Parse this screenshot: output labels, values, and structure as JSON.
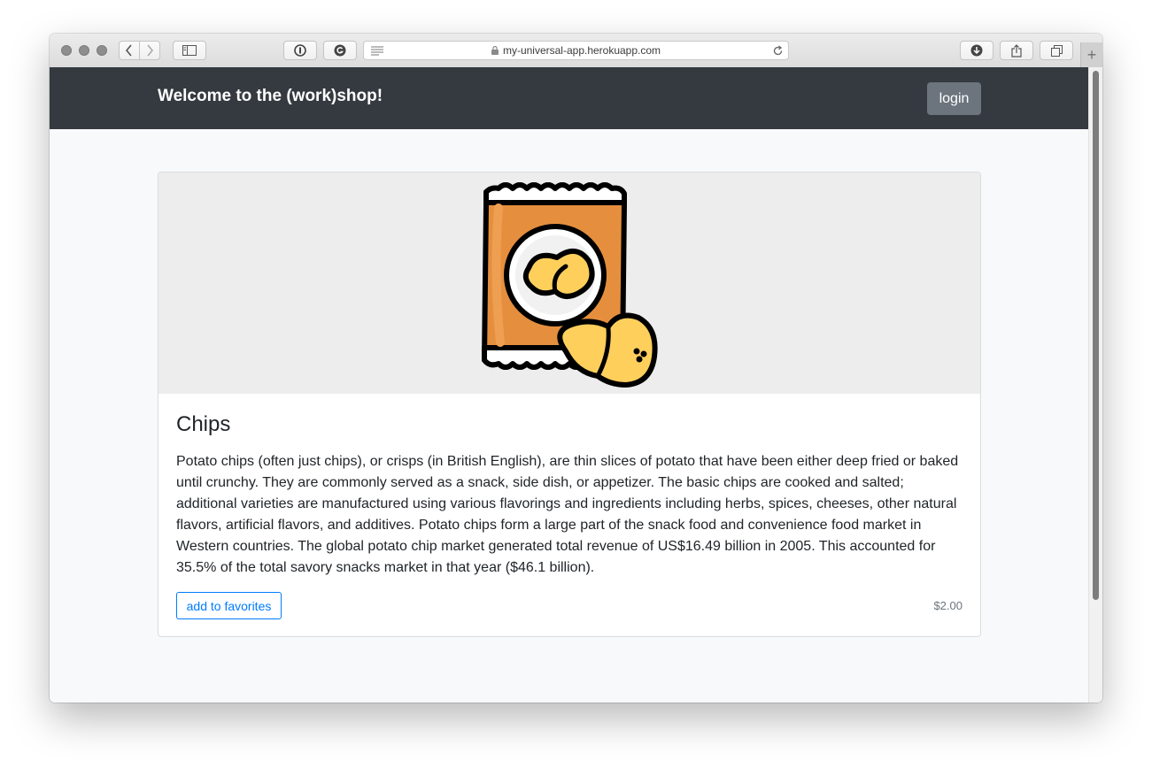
{
  "browser": {
    "url": "my-universal-app.herokuapp.com",
    "new_tab_label": "+"
  },
  "navbar": {
    "brand": "Welcome to the (work)shop!",
    "login_label": "login"
  },
  "product": {
    "title": "Chips",
    "description": "Potato chips (often just chips), or crisps (in British English), are thin slices of potato that have been either deep fried or baked until crunchy. They are commonly served as a snack, side dish, or appetizer. The basic chips are cooked and salted; additional varieties are manufactured using various flavorings and ingredients including herbs, spices, cheeses, other natural flavors, artificial flavors, and additives. Potato chips form a large part of the snack food and convenience food market in Western countries. The global potato chip market generated total revenue of US$16.49 billion in 2005. This accounted for 35.5% of the total savory snacks market in that year ($46.1 billion).",
    "favorite_label": "add to favorites",
    "price": "$2.00",
    "image_icon": "chips-bag-icon"
  },
  "colors": {
    "navbar_bg": "#343a40",
    "primary": "#007bff",
    "secondary": "#6c757d",
    "bag_orange": "#e58f3e",
    "chip_yellow": "#ffcf5c"
  }
}
